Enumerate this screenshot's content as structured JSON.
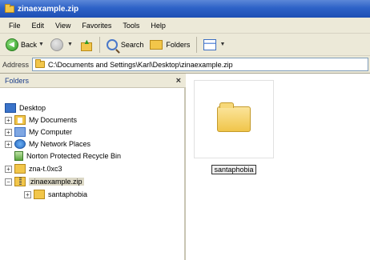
{
  "window": {
    "title": "zinaexample.zip"
  },
  "menu": [
    "File",
    "Edit",
    "View",
    "Favorites",
    "Tools",
    "Help"
  ],
  "toolbar": {
    "back_label": "Back",
    "search_label": "Search",
    "folders_label": "Folders"
  },
  "address": {
    "label": "Address",
    "path": "C:\\Documents and Settings\\Karl\\Desktop\\zinaexample.zip"
  },
  "folders_pane": {
    "title": "Folders",
    "items": [
      {
        "label": "Desktop"
      },
      {
        "label": "My Documents"
      },
      {
        "label": "My Computer"
      },
      {
        "label": "My Network Places"
      },
      {
        "label": "Norton Protected Recycle Bin"
      },
      {
        "label": "zna-t.0xc3"
      },
      {
        "label": "zinaexample.zip"
      },
      {
        "label": "santaphobia"
      }
    ]
  },
  "content": {
    "items": [
      {
        "name": "santaphobia",
        "icon": "folder-icon"
      }
    ]
  }
}
